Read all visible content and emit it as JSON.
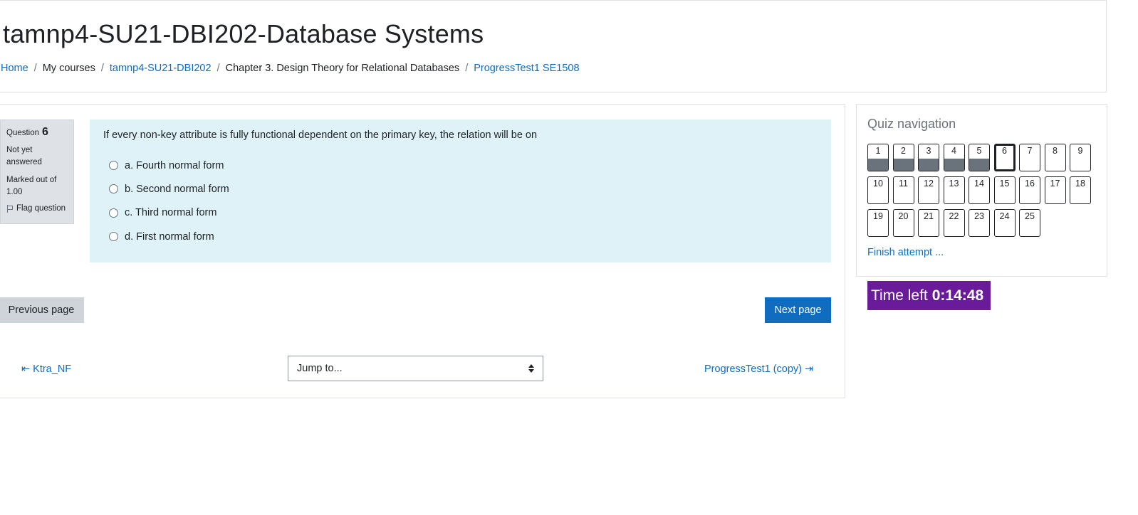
{
  "page": {
    "title": "tamnp4-SU21-DBI202-Database Systems"
  },
  "breadcrumb": [
    {
      "label": "Home",
      "link": true
    },
    {
      "label": "My courses",
      "link": false
    },
    {
      "label": "tamnp4-SU21-DBI202",
      "link": true
    },
    {
      "label": "Chapter 3. Design Theory for Relational Databases",
      "link": false
    },
    {
      "label": "ProgressTest1 SE1508",
      "link": true
    }
  ],
  "question_info": {
    "question_label": "Question",
    "number": "6",
    "state": "Not yet answered",
    "grade": "Marked out of 1.00",
    "flag_label": "Flag question"
  },
  "question": {
    "text": "If every non-key attribute is fully functional dependent on the primary key, the relation will be on",
    "answers": [
      "a. Fourth normal form",
      "b. Second normal form",
      "c. Third normal form",
      "d. First normal form"
    ]
  },
  "buttons": {
    "previous": "Previous page",
    "next": "Next page"
  },
  "activity_nav": {
    "prev_label": "Ktra_NF",
    "next_label": "ProgressTest1 (copy)",
    "prev_arrow": "⇤",
    "next_arrow": "⇤",
    "jump_placeholder": "Jump to..."
  },
  "quiz_nav": {
    "title": "Quiz navigation",
    "questions": [
      {
        "n": "1",
        "state": "answered"
      },
      {
        "n": "2",
        "state": "answered"
      },
      {
        "n": "3",
        "state": "answered"
      },
      {
        "n": "4",
        "state": "answered"
      },
      {
        "n": "5",
        "state": "answered"
      },
      {
        "n": "6",
        "state": "current"
      },
      {
        "n": "7",
        "state": "notyet"
      },
      {
        "n": "8",
        "state": "notyet"
      },
      {
        "n": "9",
        "state": "notyet"
      },
      {
        "n": "10",
        "state": "notyet"
      },
      {
        "n": "11",
        "state": "notyet"
      },
      {
        "n": "12",
        "state": "notyet"
      },
      {
        "n": "13",
        "state": "notyet"
      },
      {
        "n": "14",
        "state": "notyet"
      },
      {
        "n": "15",
        "state": "notyet"
      },
      {
        "n": "16",
        "state": "notyet"
      },
      {
        "n": "17",
        "state": "notyet"
      },
      {
        "n": "18",
        "state": "notyet"
      },
      {
        "n": "19",
        "state": "notyet"
      },
      {
        "n": "20",
        "state": "notyet"
      },
      {
        "n": "21",
        "state": "notyet"
      },
      {
        "n": "22",
        "state": "notyet"
      },
      {
        "n": "23",
        "state": "notyet"
      },
      {
        "n": "24",
        "state": "notyet"
      },
      {
        "n": "25",
        "state": "notyet"
      }
    ],
    "finish_label": "Finish attempt ..."
  },
  "timer": {
    "label": "Time left",
    "value": "0:14:48"
  },
  "colors": {
    "link": "#0f6cbf",
    "question_bg": "#def2f8",
    "timer_bg": "#6a1b9a",
    "primary": "#0f6cbf"
  }
}
